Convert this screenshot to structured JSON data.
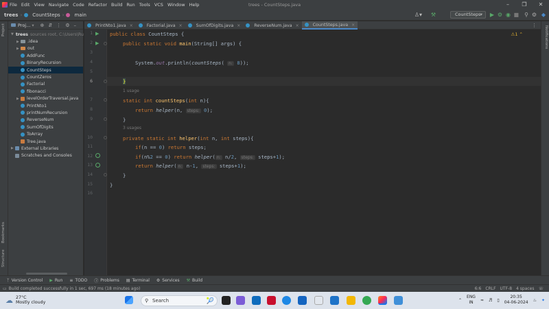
{
  "window": {
    "title": "trees - CountSteps.java",
    "menu": [
      "File",
      "Edit",
      "View",
      "Navigate",
      "Code",
      "Refactor",
      "Build",
      "Run",
      "Tools",
      "VCS",
      "Window",
      "Help"
    ]
  },
  "navbar": {
    "project": "trees",
    "crumb1": "CountSteps",
    "crumb2": "main",
    "run_config": "CountSteps"
  },
  "left_strip": {
    "project": "Project",
    "bookmarks": "Bookmarks",
    "structure": "Structure"
  },
  "right_strip": {
    "notifications": "Notifications"
  },
  "project_panel": {
    "header": "Proj...",
    "root": {
      "name": "trees",
      "path": "sources root, C:\\Users\\Ru"
    },
    "items": [
      {
        "label": ".idea",
        "kind": "folder"
      },
      {
        "label": "out",
        "kind": "folder-orange"
      },
      {
        "label": "AddFunc",
        "kind": "class"
      },
      {
        "label": "BinaryRecursion",
        "kind": "class"
      },
      {
        "label": "CountSteps",
        "kind": "class",
        "selected": true
      },
      {
        "label": "CountZeros",
        "kind": "class"
      },
      {
        "label": "Factorial",
        "kind": "class"
      },
      {
        "label": "fibonacci",
        "kind": "class"
      },
      {
        "label": "levelOrderTraversal.java",
        "kind": "java"
      },
      {
        "label": "PrintNto1",
        "kind": "class"
      },
      {
        "label": "printNumRecursion",
        "kind": "class"
      },
      {
        "label": "ReverseNum",
        "kind": "class"
      },
      {
        "label": "SumOfDigits",
        "kind": "class"
      },
      {
        "label": "ToArray",
        "kind": "class"
      },
      {
        "label": "Tree.java",
        "kind": "java"
      }
    ],
    "external_libraries": "External Libraries",
    "scratches": "Scratches and Consoles"
  },
  "tabs": [
    {
      "label": "PrintNto1.java",
      "active": false
    },
    {
      "label": "Factorial.java",
      "active": false
    },
    {
      "label": "SumOfDigits.java",
      "active": false
    },
    {
      "label": "ReverseNum.java",
      "active": false
    },
    {
      "label": "CountSteps.java",
      "active": true
    }
  ],
  "editor": {
    "warning_count": "1",
    "usage1": "1 usage",
    "usage2": "3 usages",
    "hints": {
      "n": "n:",
      "steps": "steps:"
    },
    "line_numbers": [
      "1",
      "2",
      "3",
      "4",
      "5",
      "6",
      "7",
      "8",
      "9",
      "10",
      "11",
      "12",
      "13",
      "14",
      "15",
      "16"
    ],
    "code": {
      "l1": {
        "kw": "public class ",
        "name": "CountSteps",
        "rest": " {"
      },
      "l2": {
        "kw": "public static void ",
        "fn": "main",
        "rest": "(String[] args) {"
      },
      "l4": {
        "pre": "System.",
        "field": "out",
        "mid": ".println(",
        "call": "countSteps",
        "arg": " 8",
        "end": "));"
      },
      "l6": "}",
      "l7": {
        "kw": "static int ",
        "fn": "countSteps",
        "mid": "(",
        "kw2": "int ",
        "param": "n",
        "end": "){"
      },
      "l8": {
        "kw": "return ",
        "call": "helper",
        "a": "(n, ",
        "b": " 0",
        "end": ");"
      },
      "l9": "}",
      "l10": {
        "kw": "private static int ",
        "fn": "helper",
        "mid": "(",
        "kw2": "int ",
        "p1": "n, ",
        "kw3": "int ",
        "p2": "steps){"
      },
      "l11": {
        "kw": "if",
        "a": "(n == ",
        "num": "0",
        "b": ") ",
        "kw2": "return ",
        "c": "steps;"
      },
      "l12": {
        "kw": "if",
        "a": "(n%",
        "num": "2",
        "b": " == ",
        "num2": "0",
        "c": ") ",
        "kw2": "return ",
        "call": "helper",
        "d": "(",
        "e": " n/",
        "num3": "2",
        "f": ", ",
        "g": " steps+",
        "num4": "1",
        "h": ");"
      },
      "l13": {
        "kw": "return ",
        "call": "helper",
        "d": "(",
        "e": " n-",
        "num": "1",
        "f": ", ",
        "g": " steps+",
        "num2": "1",
        "h": ");"
      },
      "l14": "}",
      "l15": "}"
    }
  },
  "bottom_tools": [
    "Version Control",
    "Run",
    "TODO",
    "Problems",
    "Terminal",
    "Services",
    "Build"
  ],
  "status": {
    "message": "Build completed successfully in 1 sec, 697 ms (18 minutes ago)",
    "position": "6:6",
    "line_sep": "CRLF",
    "encoding": "UTF-8",
    "indent": "4 spaces"
  },
  "taskbar": {
    "temp": "27°C",
    "weather": "Mostly cloudy",
    "search": "Search",
    "lang1": "ENG",
    "lang2": "IN",
    "time": "20:35",
    "date": "04-06-2024"
  },
  "colors": {
    "accent": "#4a88c7",
    "keyword": "#cc7832",
    "function": "#ffc66d",
    "number": "#6897bb"
  }
}
